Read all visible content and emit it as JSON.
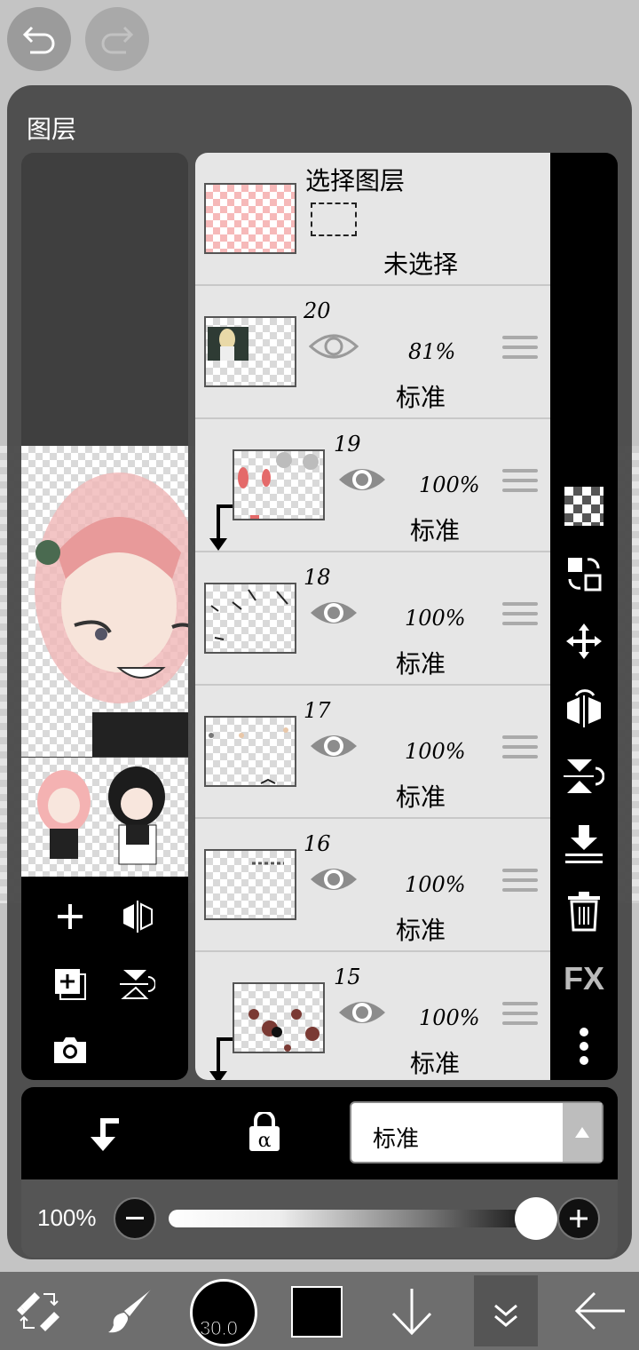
{
  "top_buttons": {
    "undo_icon": "undo-icon",
    "redo_icon": "redo-icon"
  },
  "panel": {
    "title": "图层"
  },
  "selection_layer": {
    "title": "选择图层",
    "status": "未选择"
  },
  "layers": [
    {
      "number": "20",
      "opacity": "81%",
      "mode": "标准",
      "clipped": false,
      "eye_dim": true
    },
    {
      "number": "19",
      "opacity": "100%",
      "mode": "标准",
      "clipped": true,
      "eye_dim": false
    },
    {
      "number": "18",
      "opacity": "100%",
      "mode": "标准",
      "clipped": false,
      "eye_dim": false
    },
    {
      "number": "17",
      "opacity": "100%",
      "mode": "标准",
      "clipped": false,
      "eye_dim": false
    },
    {
      "number": "16",
      "opacity": "100%",
      "mode": "标准",
      "clipped": false,
      "eye_dim": false
    },
    {
      "number": "15",
      "opacity": "100%",
      "mode": "标准",
      "clipped": true,
      "eye_dim": false
    }
  ],
  "right_toolbar": {
    "fx_label": "FX"
  },
  "blend": {
    "mode": "标准"
  },
  "opacity": {
    "label": "100%",
    "value": 1.0
  },
  "bottom_bar": {
    "brush_size": "30.0",
    "color": "#000000"
  }
}
